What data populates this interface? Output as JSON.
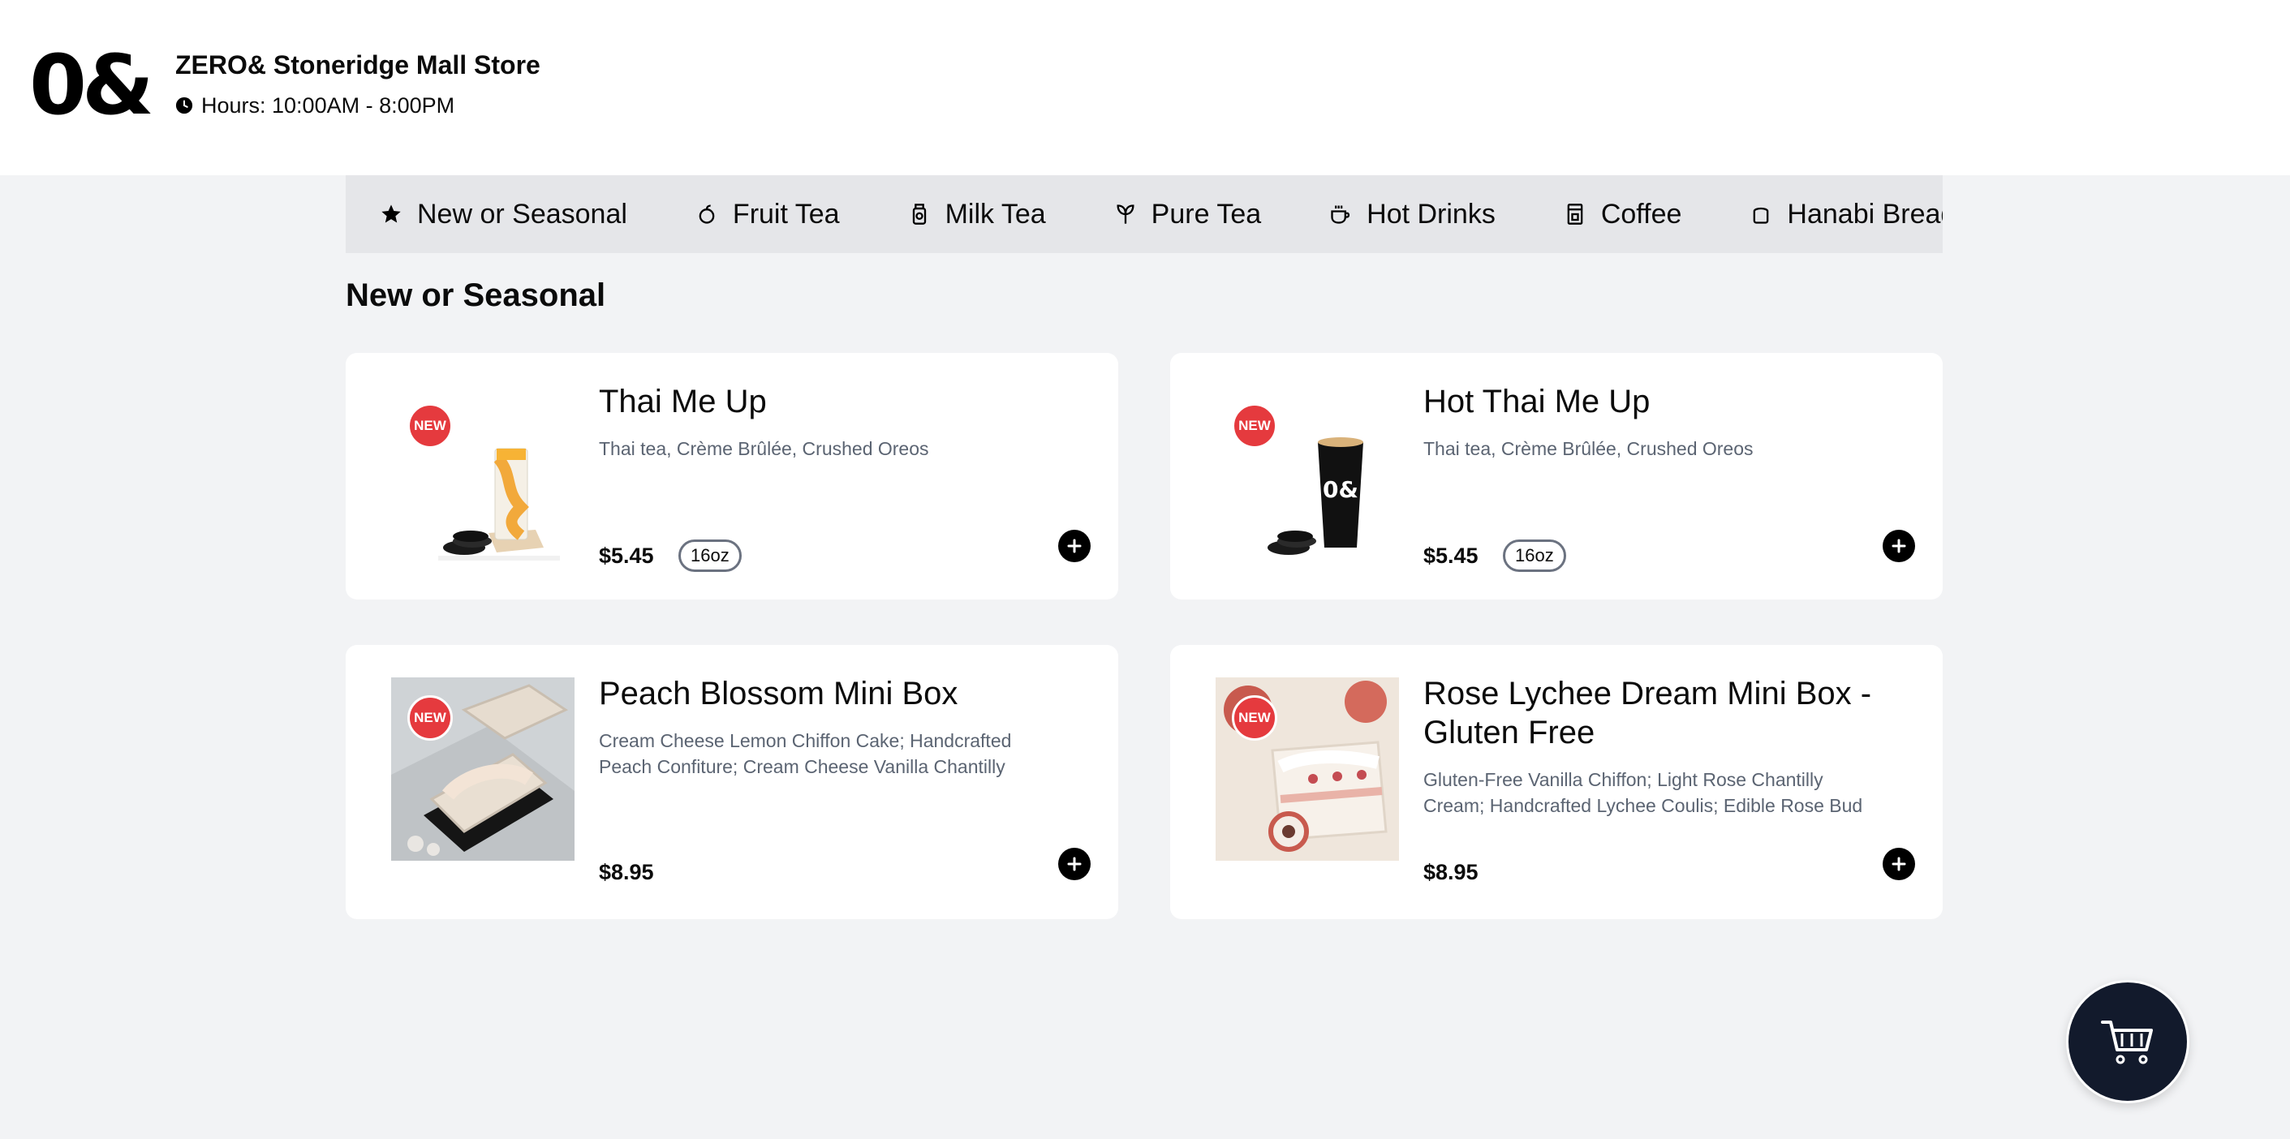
{
  "header": {
    "logo_text": "0&",
    "store_name": "ZERO& Stoneridge Mall Store",
    "hours": "Hours: 10:00AM - 8:00PM"
  },
  "categories": [
    {
      "label": "New or Seasonal",
      "icon": "star-icon"
    },
    {
      "label": "Fruit Tea",
      "icon": "fruit-icon"
    },
    {
      "label": "Milk Tea",
      "icon": "milk-bottle-icon"
    },
    {
      "label": "Pure Tea",
      "icon": "tea-leaf-icon"
    },
    {
      "label": "Hot Drinks",
      "icon": "coffee-cup-icon"
    },
    {
      "label": "Coffee",
      "icon": "coffee-machine-icon"
    },
    {
      "label": "Hanabi Bread",
      "icon": "bread-icon"
    }
  ],
  "section_title": "New or Seasonal",
  "badge_new": "NEW",
  "products": [
    {
      "title": "Thai Me Up",
      "description": "Thai tea, Crème Brûlée, Crushed Oreos",
      "price": "$5.45",
      "size": "16oz",
      "image": "iced-thai-tea-cup"
    },
    {
      "title": "Hot Thai Me Up",
      "description": "Thai tea, Crème Brûlée, Crushed Oreos",
      "price": "$5.45",
      "size": "16oz",
      "image": "hot-thai-tea-cup",
      "cup_logo": "0&"
    },
    {
      "title": "Peach Blossom Mini Box",
      "description": "Cream Cheese Lemon Chiffon Cake; Handcrafted Peach Confiture; Cream Cheese Vanilla Chantilly",
      "price": "$8.95",
      "image": "peach-cake-box"
    },
    {
      "title": "Rose Lychee Dream Mini Box - Gluten Free",
      "description": "Gluten-Free Vanilla Chiffon; Light Rose Chantilly Cream; Handcrafted Lychee Coulis; Edible Rose Bud",
      "price": "$8.95",
      "image": "rose-lychee-cake-box"
    }
  ],
  "colors": {
    "page_bg": "#f2f3f5",
    "nav_bg": "#e5e6e9",
    "new_badge": "#e53a3e",
    "cart_button": "#121a2c",
    "description_text": "#5b6472"
  },
  "cart": {
    "icon": "cart-icon"
  }
}
